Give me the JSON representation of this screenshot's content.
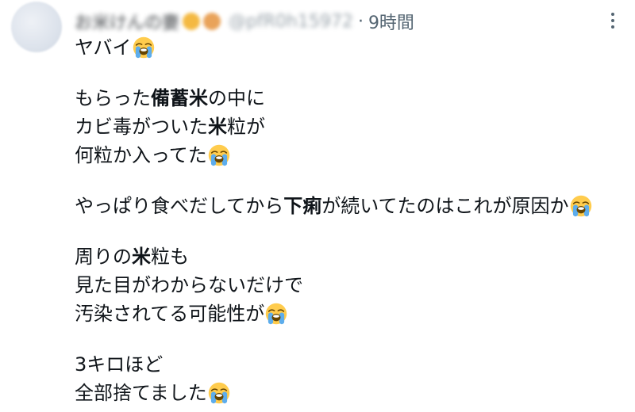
{
  "tweet": {
    "author": {
      "display_name": "お米けんの妻",
      "handle": "@pfR0h15972",
      "avatar_icon": "avatar"
    },
    "separator": "·",
    "time": "9時間",
    "more_icon": "more-vertical-icon",
    "text": {
      "line1": "ヤバイ",
      "line2_a": "もらった",
      "line2_b": "備蓄米",
      "line2_c": "の中に",
      "line3_a": "カビ毒がついた",
      "line3_b": "米",
      "line3_c": "粒が",
      "line4": "何粒か入ってた",
      "line5_a": "やっぱり食べだしてから",
      "line5_b": "下痢",
      "line5_c": "が続いてたのはこれが原因か",
      "line6_a": "周りの",
      "line6_b": "米",
      "line6_c": "粒も",
      "line7": "見た目がわからないだけで",
      "line8": "汚染されてる可能性が",
      "line9": "3キロほど",
      "line10": "全部捨てました"
    },
    "emoji_icon": "loudly-crying-face-icon"
  }
}
